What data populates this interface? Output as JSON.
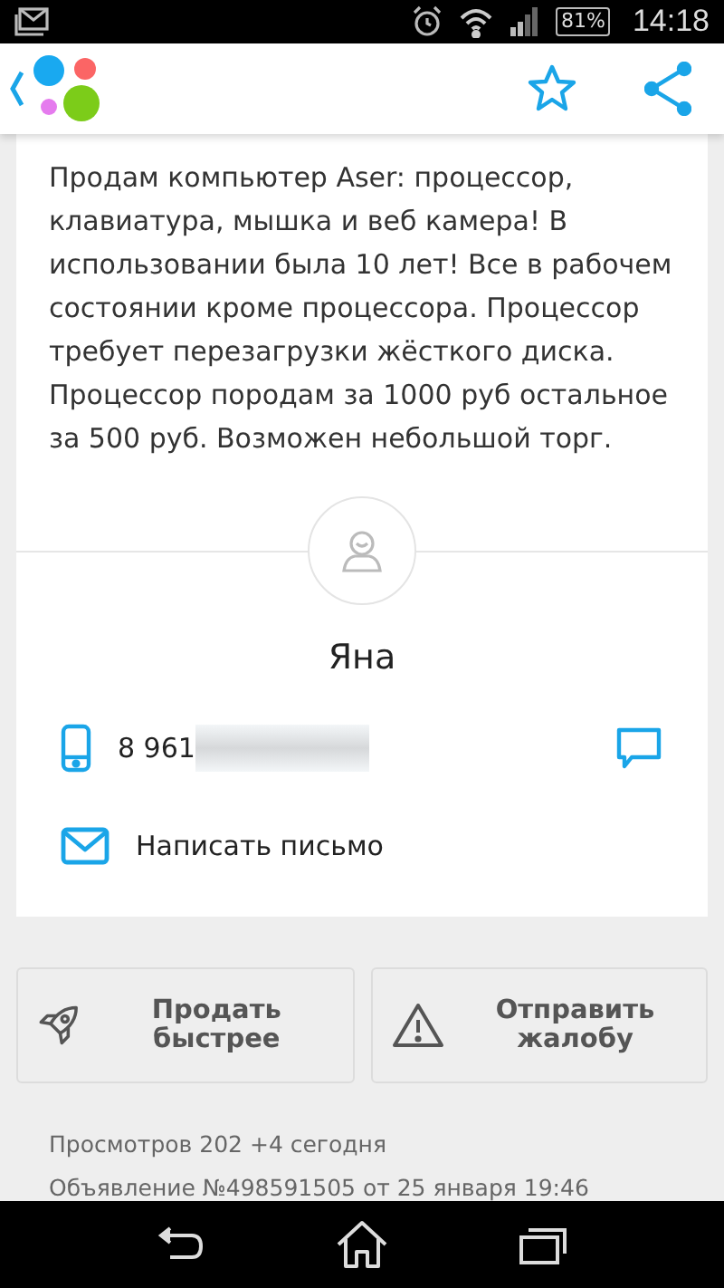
{
  "status_bar": {
    "battery": "81%",
    "time": "14:18"
  },
  "description": "Продам компьютер Aser: процессор, клавиатура, мышка и веб камера! В использовании была 10 лет! Все в рабочем состоянии кроме процессора. Процессор требует перезагрузки жёсткого диска. Процессор породам за 1000 руб остальное за 500 руб. Возможен небольшой торг.",
  "seller": {
    "name": "Яна",
    "phone": "8 961",
    "email_action": "Написать письмо"
  },
  "buttons": [
    {
      "kind": "rocket",
      "label": "Продать быстрее"
    },
    {
      "kind": "warning",
      "label": "Отправить жалобу"
    }
  ],
  "stats": [
    "Просмотров 202 +4 сегодня",
    "Объявление №498591505 от 25 января 19:46"
  ]
}
